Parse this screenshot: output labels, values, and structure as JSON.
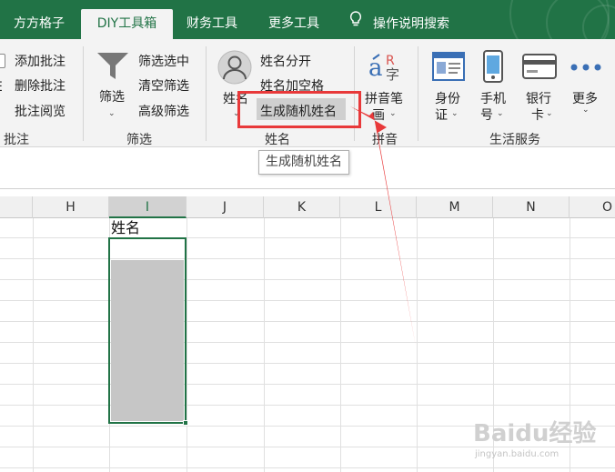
{
  "tabs": [
    {
      "label": "方方格子"
    },
    {
      "label": "DIY工具箱"
    },
    {
      "label": "财务工具"
    },
    {
      "label": "更多工具"
    }
  ],
  "tell_me": "操作说明搜索",
  "ribbon": {
    "annotate": {
      "items": [
        "添加批注",
        "删除批注",
        "批注阅览"
      ],
      "edge_char": "E",
      "group": "批注"
    },
    "filter": {
      "big_label": "筛选",
      "items": [
        "筛选选中",
        "清空筛选",
        "高级筛选"
      ],
      "group": "筛选"
    },
    "name": {
      "big_label": "姓名",
      "items": [
        "姓名分开",
        "姓名加空格",
        "生成随机姓名"
      ],
      "group": "姓名"
    },
    "pinyin": {
      "big_line1": "拼音笔",
      "big_line2": "画",
      "group": "拼音"
    },
    "life": {
      "items": [
        {
          "line1": "身份",
          "line2": "证"
        },
        {
          "line1": "手机",
          "line2": "号"
        },
        {
          "line1": "银行",
          "line2": "卡"
        },
        {
          "line1": "更多",
          "line2": ""
        }
      ],
      "group": "生活服务"
    }
  },
  "tooltip": "生成随机姓名",
  "sheet": {
    "columns": [
      "H",
      "I",
      "J",
      "K",
      "L",
      "M",
      "N",
      "O"
    ],
    "selected_column": "I",
    "header_cell": "姓名"
  },
  "watermark": {
    "main": "Baidu经验",
    "sub": "jingyan.baidu.com"
  },
  "colors": {
    "excel_green": "#217346",
    "highlight_red": "#e8393a"
  }
}
